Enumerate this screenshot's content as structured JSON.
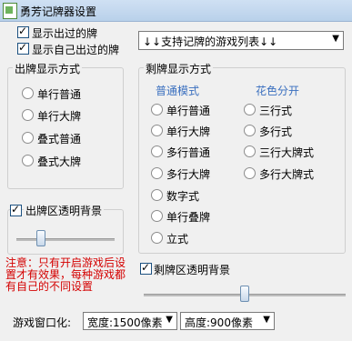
{
  "window": {
    "title": "勇芳记牌器设置"
  },
  "top": {
    "show_played": "显示出过的牌",
    "show_self_played": "显示自己出过的牌",
    "game_list_combo": "↓↓支持记牌的游戏列表↓↓"
  },
  "played_group": {
    "title": "出牌显示方式",
    "options": [
      "单行普通",
      "单行大牌",
      "叠式普通",
      "叠式大牌"
    ]
  },
  "remaining_group": {
    "title": "剩牌显示方式",
    "normal_header": "普通模式",
    "suit_header": "花色分开",
    "normal_options": [
      "单行普通",
      "单行大牌",
      "多行普通",
      "多行大牌",
      "数字式",
      "单行叠牌",
      "立式"
    ],
    "suit_options": [
      "三行式",
      "多行式",
      "三行大牌式",
      "多行大牌式"
    ]
  },
  "played_transparent": {
    "label": "出牌区透明背景",
    "slider_value": 0.25
  },
  "remaining_transparent": {
    "label": "剩牌区透明背景",
    "slider_value": 0.5
  },
  "note": "注意：只有开启游戏后设置才有效果，每种游戏都有自己的不同设置",
  "window_size": {
    "label": "游戏窗口化:",
    "width_combo": "宽度:1500像素",
    "height_combo": "高度:900像素"
  },
  "colors": {
    "note": "#d40000",
    "header_blue": "#3a6fbf"
  },
  "icons": [
    "checkbox-icon",
    "radio-icon",
    "dropdown-arrow-icon",
    "app-icon"
  ]
}
